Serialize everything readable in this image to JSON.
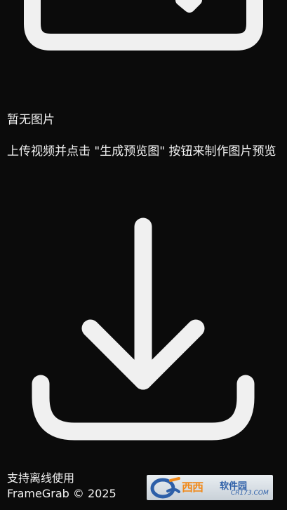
{
  "empty_state": {
    "title": "暂无图片",
    "hint": "上传视频并点击 \"生成预览图\" 按钮来制作图片预览"
  },
  "icons": {
    "top": "image-placeholder-icon",
    "center": "download-icon"
  },
  "footer": {
    "offline_text": "支持离线使用",
    "copyright": "FrameGrab © 2025"
  },
  "watermark": {
    "brand": "西西",
    "tail": "软件园",
    "domain": "CR173.COM"
  },
  "colors": {
    "background": "#0b0b0b",
    "foreground": "#f2f2f2"
  }
}
